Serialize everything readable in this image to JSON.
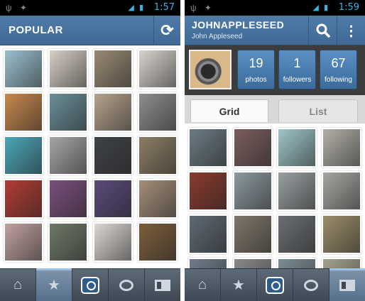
{
  "left": {
    "status_time": "1:57",
    "title": "POPULAR",
    "thumbs": [
      "#9bc0cf",
      "#d8cfc6",
      "#9a8a74",
      "#d9d3cd",
      "#c7884c",
      "#6a8f99",
      "#b6a38d",
      "#8e8f8c",
      "#4aa7b8",
      "#a6a6a6",
      "#3f4246",
      "#8d7e66",
      "#b33b33",
      "#7a4f7d",
      "#5a4a7a",
      "#a58f7a",
      "#c0a2a0",
      "#6f7968",
      "#dcd7d3",
      "#7c5e3c"
    ]
  },
  "right": {
    "status_time": "1:59",
    "username": "JOHNAPPLESEED",
    "fullname": "John Appleseed",
    "stats": [
      {
        "num": "19",
        "label": "photos"
      },
      {
        "num": "1",
        "label": "followers"
      },
      {
        "num": "67",
        "label": "following"
      }
    ],
    "tab_grid": "Grid",
    "tab_list": "List",
    "thumbs": [
      "#6b7b83",
      "#7a5d5d",
      "#9fc6c9",
      "#b3b0a8",
      "#8a3a2e",
      "#8c9aa0",
      "#9aa0a2",
      "#a6a6a2",
      "#5f6a74",
      "#7e766a",
      "#6b6f73",
      "#9c8e6a",
      "#6f7d8b",
      "#8a8a8a",
      "#7c8e96",
      "#a5a38f"
    ]
  },
  "nav": [
    "home-icon",
    "star-icon",
    "camera-icon",
    "bubble-icon",
    "news-icon"
  ]
}
